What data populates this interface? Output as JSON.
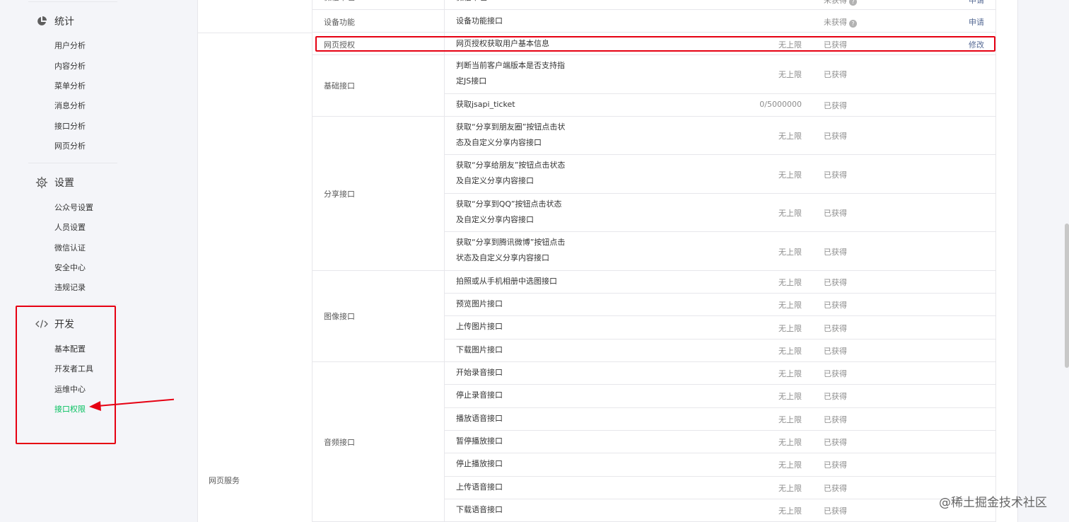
{
  "sidebar": {
    "stats": {
      "title": "统计",
      "icon": "pie-chart-icon",
      "items": [
        "用户分析",
        "内容分析",
        "菜单分析",
        "消息分析",
        "接口分析",
        "网页分析"
      ]
    },
    "settings": {
      "title": "设置",
      "icon": "gear-icon",
      "items": [
        "公众号设置",
        "人员设置",
        "微信认证",
        "安全中心",
        "违规记录"
      ]
    },
    "dev": {
      "title": "开发",
      "icon": "code-icon",
      "items": [
        "基本配置",
        "开发者工具",
        "运维中心",
        "接口权限"
      ],
      "active_index": 3
    }
  },
  "main": {
    "category": "网页服务",
    "top_partial_row": {
      "name": "微信卡包",
      "status": "未获得",
      "action": "申请"
    },
    "device_row": {
      "group": "设备功能",
      "name": "设备功能接口",
      "status": "未获得",
      "action": "申请"
    },
    "auth_row": {
      "group": "网页授权",
      "name": "网页授权获取用户基本信息",
      "limit": "无上限",
      "status": "已获得",
      "action": "修改"
    },
    "groups": [
      {
        "label": "基础接口",
        "rows": [
          {
            "lines": [
              "判断当前客户端版本是否支持指",
              "定JS接口"
            ],
            "limit": "无上限",
            "status": "已获得"
          },
          {
            "lines": [
              "获取jsapi_ticket"
            ],
            "limit": "0/5000000",
            "status": "已获得"
          }
        ]
      },
      {
        "label": "分享接口",
        "rows": [
          {
            "lines": [
              "获取“分享到朋友圈”按钮点击状",
              "态及自定义分享内容接口"
            ],
            "limit": "无上限",
            "status": "已获得"
          },
          {
            "lines": [
              "获取“分享给朋友”按钮点击状态",
              "及自定义分享内容接口"
            ],
            "limit": "无上限",
            "status": "已获得"
          },
          {
            "lines": [
              "获取“分享到QQ”按钮点击状态",
              "及自定义分享内容接口"
            ],
            "limit": "无上限",
            "status": "已获得"
          },
          {
            "lines": [
              "获取“分享到腾讯微博”按钮点击",
              "状态及自定义分享内容接口"
            ],
            "limit": "无上限",
            "status": "已获得"
          }
        ]
      },
      {
        "label": "图像接口",
        "rows": [
          {
            "lines": [
              "拍照或从手机相册中选图接口"
            ],
            "limit": "无上限",
            "status": "已获得"
          },
          {
            "lines": [
              "预览图片接口"
            ],
            "limit": "无上限",
            "status": "已获得"
          },
          {
            "lines": [
              "上传图片接口"
            ],
            "limit": "无上限",
            "status": "已获得"
          },
          {
            "lines": [
              "下载图片接口"
            ],
            "limit": "无上限",
            "status": "已获得"
          }
        ]
      },
      {
        "label": "音频接口",
        "rows": [
          {
            "lines": [
              "开始录音接口"
            ],
            "limit": "无上限",
            "status": "已获得"
          },
          {
            "lines": [
              "停止录音接口"
            ],
            "limit": "无上限",
            "status": "已获得"
          },
          {
            "lines": [
              "播放语音接口"
            ],
            "limit": "无上限",
            "status": "已获得"
          },
          {
            "lines": [
              "暂停播放接口"
            ],
            "limit": "无上限",
            "status": "已获得"
          },
          {
            "lines": [
              "停止播放接口"
            ],
            "limit": "无上限",
            "status": "已获得"
          },
          {
            "lines": [
              "上传语音接口"
            ],
            "limit": "无上限",
            "status": "已获得"
          },
          {
            "lines": [
              "下载语音接口"
            ],
            "limit": "无上限",
            "status": "已获得"
          }
        ]
      }
    ]
  },
  "watermark": "@稀土掘金技术社区",
  "colors": {
    "active_green": "#07c160",
    "link_blue": "#576b95",
    "highlight_red": "#e60012"
  }
}
